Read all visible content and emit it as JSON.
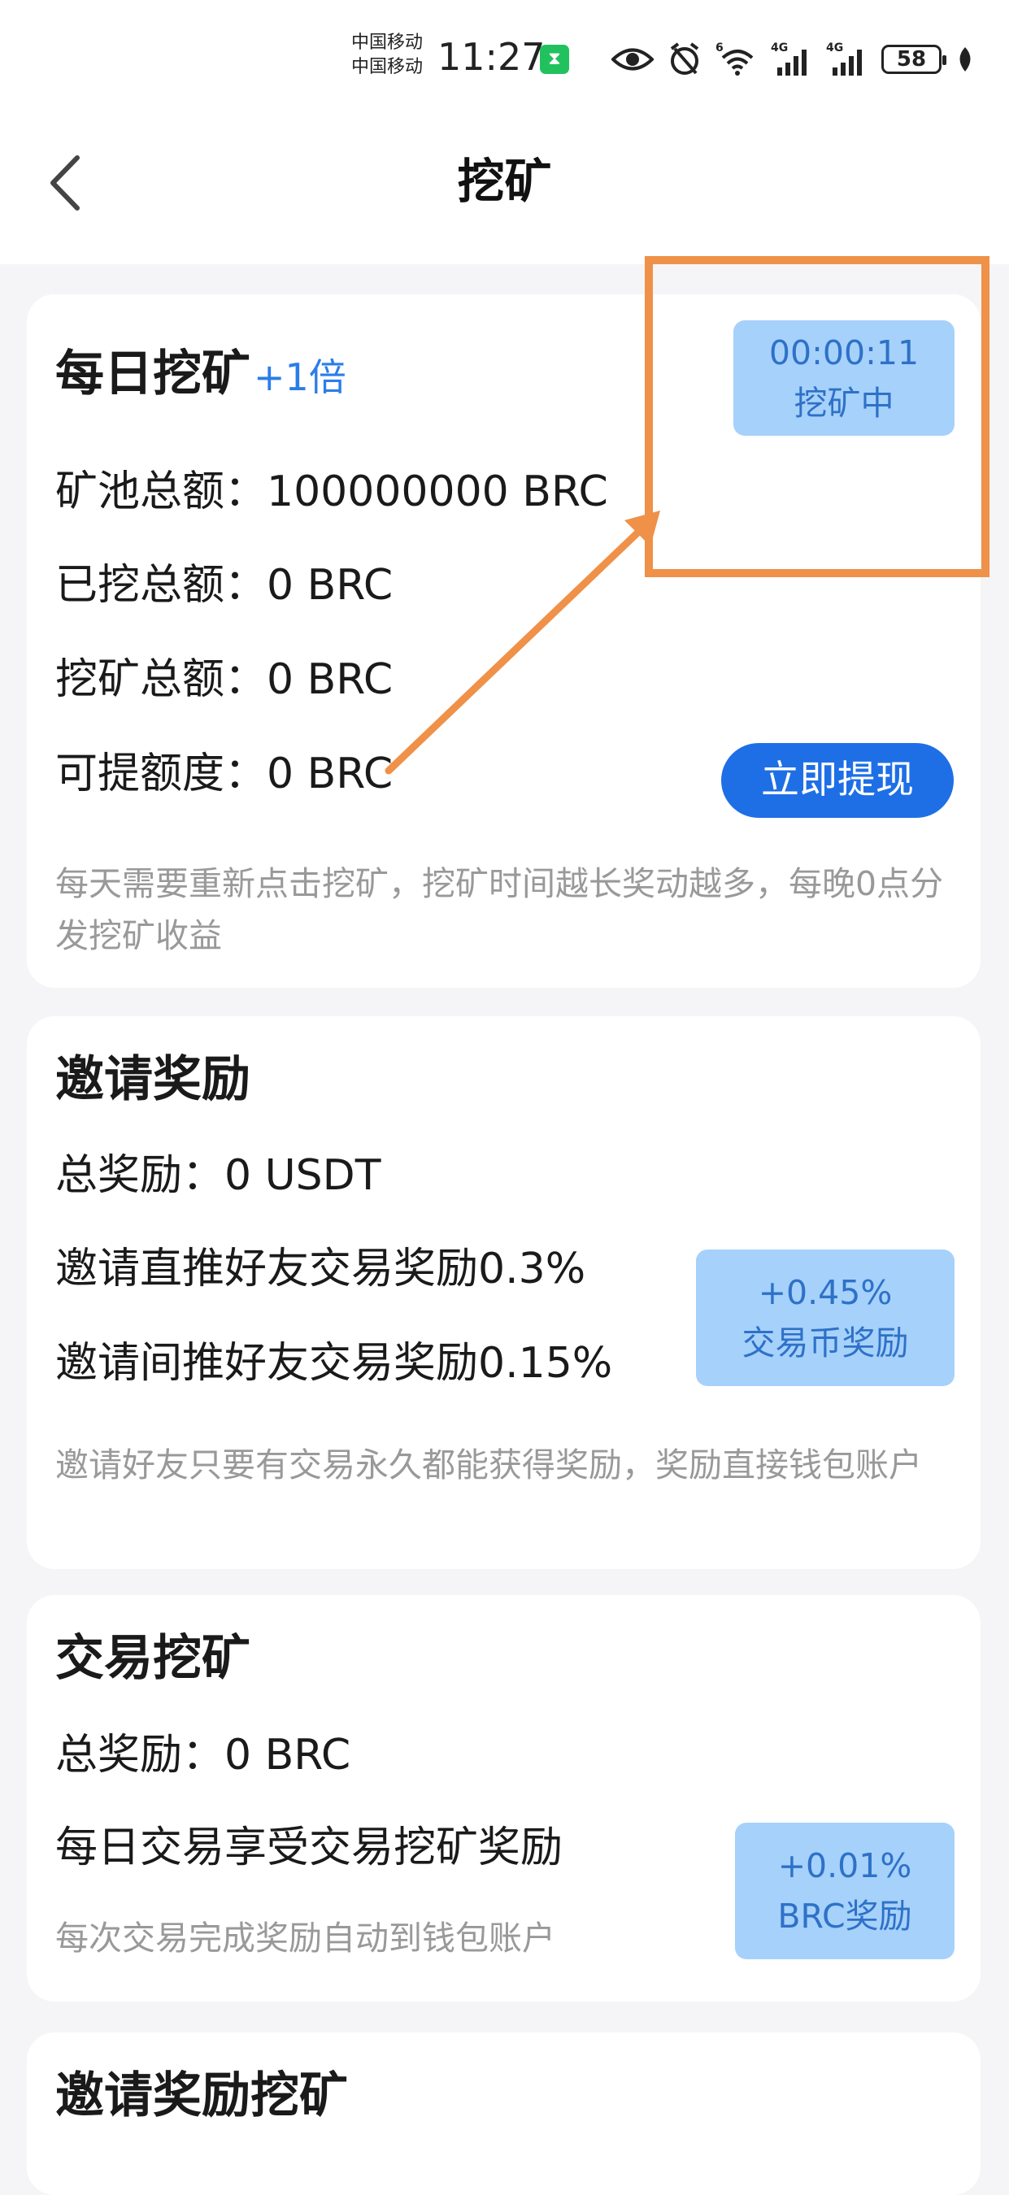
{
  "status_bar": {
    "carrier_1": "中国移动",
    "carrier_2": "中国移动",
    "time": "11:27",
    "network_1": "6",
    "network_2": "4G",
    "network_3": "4G",
    "battery": "58",
    "icons": [
      "hourglass-icon",
      "eye-icon",
      "alarm-off-icon",
      "wifi-icon",
      "signal-icon",
      "signal-icon",
      "battery-icon",
      "leaf-icon"
    ]
  },
  "nav": {
    "title": "挖矿",
    "back_icon": "chevron-left-icon"
  },
  "daily_mining": {
    "title": "每日挖矿",
    "multiplier": "+1倍",
    "timer": "00:00:11",
    "status": "挖矿中",
    "pool_total": "矿池总额：100000000 BRC",
    "mined_total": "已挖总额：0 BRC",
    "mining_total": "挖矿总额：0 BRC",
    "withdrawable": "可提额度：0 BRC",
    "withdraw_button": "立即提现",
    "note": "每天需要重新点击挖矿，挖矿时间越长奖动越多，每晚0点分发挖矿收益"
  },
  "invite_reward": {
    "title": "邀请奖励",
    "total": "总奖励：0 USDT",
    "direct": "邀请直推好友交易奖励0.3%",
    "indirect": "邀请间推好友交易奖励0.15%",
    "badge_value": "+0.45%",
    "badge_label": "交易币奖励",
    "note": "邀请好友只要有交易永久都能获得奖励，奖励直接钱包账户"
  },
  "trade_mining": {
    "title": "交易挖矿",
    "total": "总奖励：0 BRC",
    "daily": "每日交易享受交易挖矿奖励",
    "badge_value": "+0.01%",
    "badge_label": "BRC奖励",
    "note": "每次交易完成奖励自动到钱包账户"
  },
  "next_card": {
    "title": "邀请奖励挖矿"
  },
  "colors": {
    "accent_blue": "#1e6fe6",
    "link_blue": "#2b7de9",
    "badge_bg": "#a6d1fb",
    "badge_text": "#2e71c7",
    "annotation_orange": "#ef9148",
    "muted_text": "#999999",
    "page_bg": "#f5f5f7"
  }
}
